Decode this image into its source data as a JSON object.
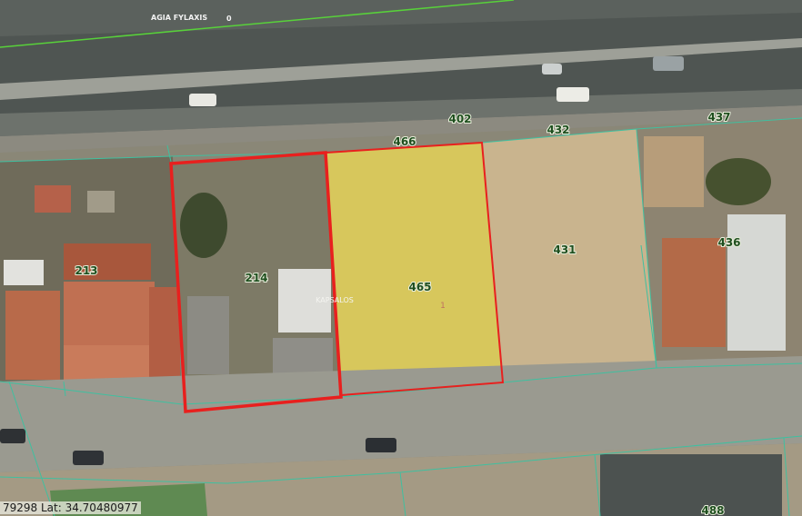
{
  "road_name": "AGIA FYLAXIS",
  "road_marker": "0",
  "district_label": "KAPSALOS",
  "sheet_marker": "1",
  "parcels": [
    "402",
    "466",
    "432",
    "437",
    "213",
    "214",
    "465",
    "431",
    "436",
    "488"
  ],
  "coordinates": "79298 Lat: 34.70480977",
  "colors": {
    "selection_outline": "#e8201e",
    "highlight_fill": "#f2e35a",
    "parcel_lines": "#3fc0a0",
    "road_line": "#58d13a"
  }
}
